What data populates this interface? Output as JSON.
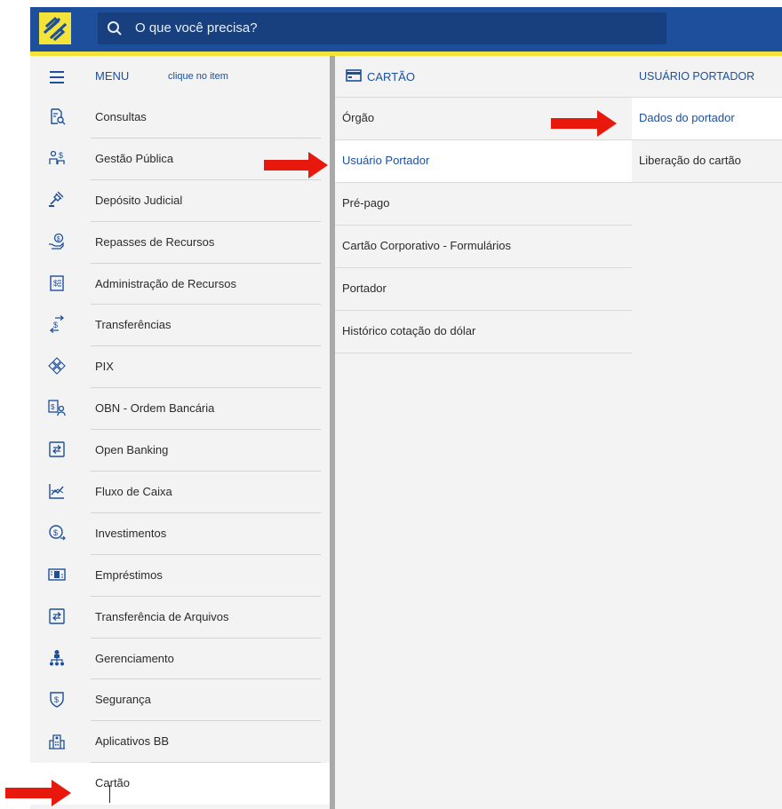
{
  "search": {
    "placeholder": "O que você precisa?"
  },
  "menu": {
    "title": "MENU",
    "hint": "clique no item",
    "items": [
      {
        "label": "Consultas",
        "icon": "document-search-icon"
      },
      {
        "label": "Gestão Pública",
        "icon": "people-money-icon"
      },
      {
        "label": "Depósito Judicial",
        "icon": "gavel-icon"
      },
      {
        "label": "Repasses de Recursos",
        "icon": "hand-coin-icon"
      },
      {
        "label": "Administração de Recursos",
        "icon": "ledger-icon"
      },
      {
        "label": "Transferências",
        "icon": "transfer-money-icon"
      },
      {
        "label": "PIX",
        "icon": "pix-icon"
      },
      {
        "label": "OBN - Ordem Bancária",
        "icon": "order-bank-icon"
      },
      {
        "label": "Open Banking",
        "icon": "exchange-square-icon"
      },
      {
        "label": "Fluxo de Caixa",
        "icon": "chart-line-icon"
      },
      {
        "label": "Investimentos",
        "icon": "coin-growth-icon"
      },
      {
        "label": "Empréstimos",
        "icon": "banknote-icon"
      },
      {
        "label": "Transferência de Arquivos",
        "icon": "file-exchange-icon"
      },
      {
        "label": "Gerenciamento",
        "icon": "org-chart-icon"
      },
      {
        "label": "Segurança",
        "icon": "shield-money-icon"
      },
      {
        "label": "Aplicativos BB",
        "icon": "building-icon"
      },
      {
        "label": "Cartão",
        "icon": "card-icon"
      }
    ]
  },
  "cartao": {
    "title": "CARTÃO",
    "items": [
      {
        "label": "Órgão"
      },
      {
        "label": "Usuário Portador"
      },
      {
        "label": "Pré-pago"
      },
      {
        "label": "Cartão Corporativo - Formulários"
      },
      {
        "label": "Portador"
      },
      {
        "label": "Histórico cotação do dólar"
      }
    ]
  },
  "portador": {
    "title": "USUÁRIO PORTADOR",
    "items": [
      {
        "label": "Dados do portador"
      },
      {
        "label": "Liberação do cartão"
      }
    ]
  },
  "colors": {
    "brand_blue": "#1d4f9c",
    "brand_yellow": "#f4e43a",
    "arrow_red": "#e8180c"
  }
}
